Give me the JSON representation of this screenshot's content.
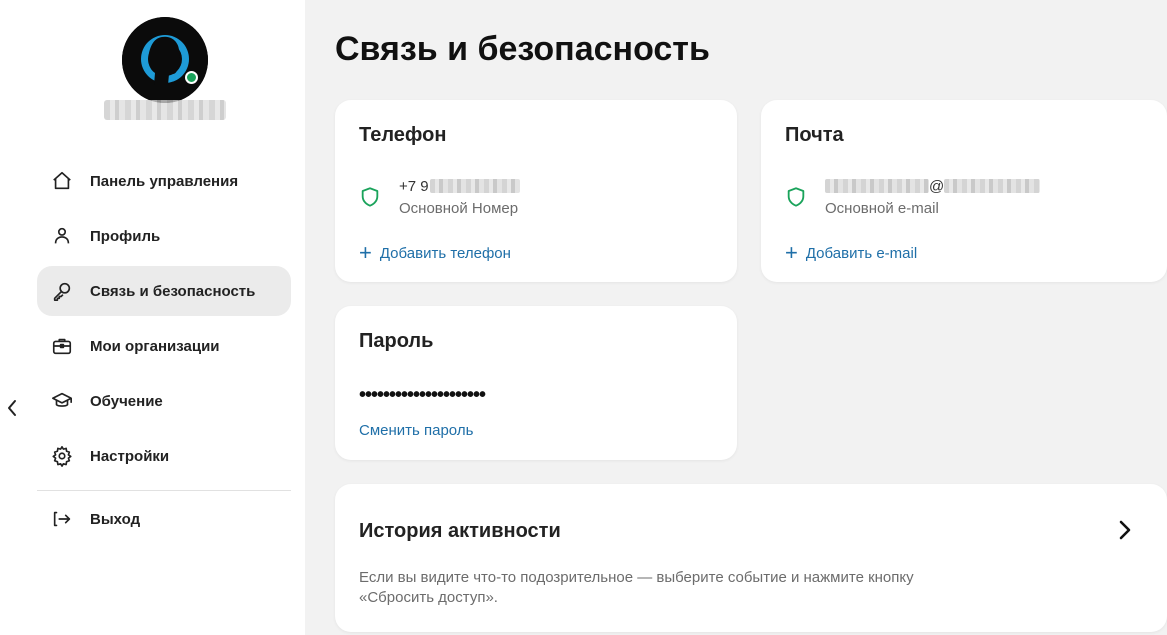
{
  "sidebar": {
    "nav": [
      {
        "label": "Панель управления",
        "icon": "home-icon"
      },
      {
        "label": "Профиль",
        "icon": "user-icon"
      },
      {
        "label": "Связь и безопасность",
        "icon": "key-icon",
        "active": true
      },
      {
        "label": "Мои организации",
        "icon": "briefcase-icon"
      },
      {
        "label": "Обучение",
        "icon": "graduation-cap-icon"
      },
      {
        "label": "Настройки",
        "icon": "gear-icon"
      }
    ],
    "logout": {
      "label": "Выход",
      "icon": "logout-icon"
    }
  },
  "main": {
    "title": "Связь и безопасность",
    "phone": {
      "title": "Телефон",
      "number_prefix": "+7 9",
      "caption": "Основной Номер",
      "add": "Добавить телефон"
    },
    "email": {
      "title": "Почта",
      "at": "@",
      "caption": "Основной e-mail",
      "add": "Добавить e-mail"
    },
    "password": {
      "title": "Пароль",
      "masked": "•••••••••••••••••••••",
      "change": "Сменить пароль"
    },
    "history": {
      "title": "История активности",
      "description": "Если вы видите что-то подозрительное — выберите событие и нажмите кнопку «Сбросить доступ»."
    }
  },
  "colors": {
    "accent_link": "#1f6fa8",
    "shield_green": "#1aa35b",
    "online_dot": "#1aa35b",
    "active_nav_bg": "#ebebeb"
  }
}
